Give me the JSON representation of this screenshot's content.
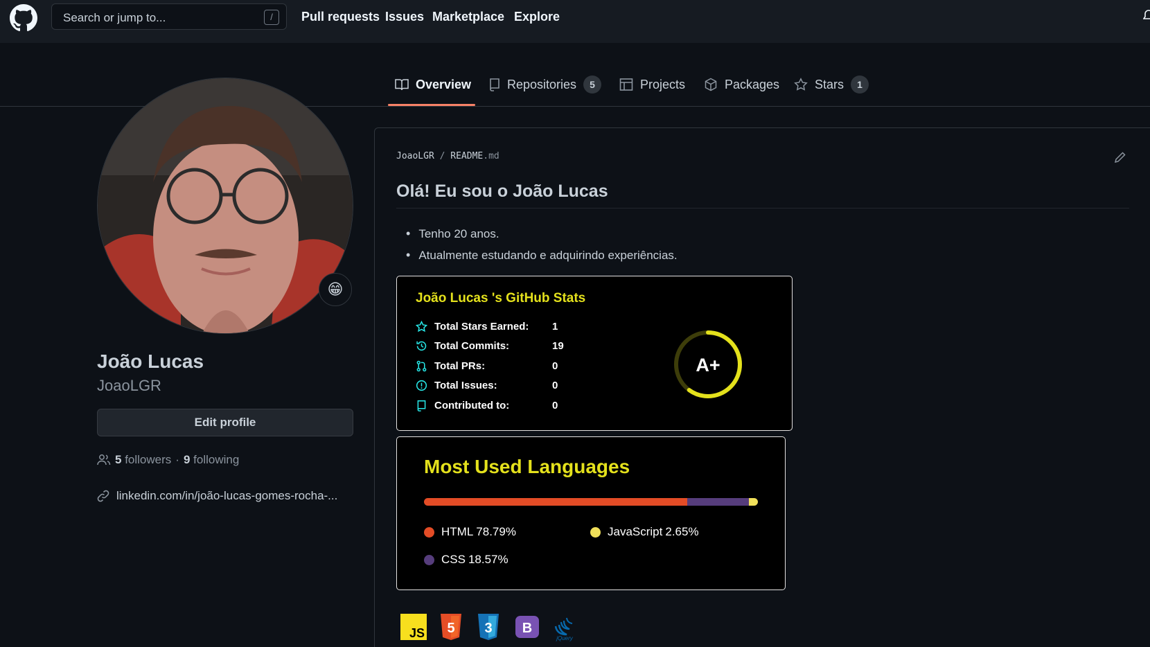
{
  "header": {
    "search_placeholder": "Search or jump to...",
    "search_shortcut": "/",
    "nav": [
      "Pull requests",
      "Issues",
      "Marketplace",
      "Explore"
    ]
  },
  "tabs": [
    {
      "label": "Overview",
      "icon": "book-icon",
      "active": true
    },
    {
      "label": "Repositories",
      "icon": "repo-icon",
      "count": "5"
    },
    {
      "label": "Projects",
      "icon": "table-icon"
    },
    {
      "label": "Packages",
      "icon": "package-icon"
    },
    {
      "label": "Stars",
      "icon": "star-icon",
      "count": "1"
    }
  ],
  "profile": {
    "name": "João Lucas",
    "login": "JoaoLGR",
    "status_emoji": "😁",
    "edit_label": "Edit profile",
    "followers_count": "5",
    "followers_label": "followers",
    "separator": "·",
    "following_count": "9",
    "following_label": "following",
    "link": "linkedin.com/in/joão-lucas-gomes-rocha-..."
  },
  "readme": {
    "owner": "JoaoLGR",
    "separator": "/",
    "file": "README",
    "ext": ".md",
    "heading": "Olá! Eu sou o João Lucas",
    "bullets": [
      "Tenho 20 anos.",
      "Atualmente estudando e adquirindo experiências."
    ]
  },
  "stats_card": {
    "title": "João Lucas 's GitHub Stats",
    "rows": [
      {
        "icon": "star-icon",
        "label": "Total Stars Earned:",
        "value": "1"
      },
      {
        "icon": "history-icon",
        "label": "Total Commits:",
        "value": "19"
      },
      {
        "icon": "pull-request-icon",
        "label": "Total PRs:",
        "value": "0"
      },
      {
        "icon": "issue-icon",
        "label": "Total Issues:",
        "value": "0"
      },
      {
        "icon": "repo-icon",
        "label": "Contributed to:",
        "value": "0"
      }
    ],
    "rank": "A+",
    "rank_progress": 0.6,
    "accent": "#e4e11c",
    "icon_color": "#27e7e7"
  },
  "languages_card": {
    "title": "Most Used Languages",
    "languages": [
      {
        "name": "HTML",
        "percent": "78.79%",
        "value": 78.79,
        "color": "#e34c26"
      },
      {
        "name": "JavaScript",
        "percent": "2.65%",
        "value": 2.65,
        "color": "#f1e05a"
      },
      {
        "name": "CSS",
        "percent": "18.57%",
        "value": 18.57,
        "color": "#563d7c"
      }
    ]
  },
  "tech_icons": [
    "JS",
    "5",
    "3",
    "B",
    "jQuery"
  ]
}
